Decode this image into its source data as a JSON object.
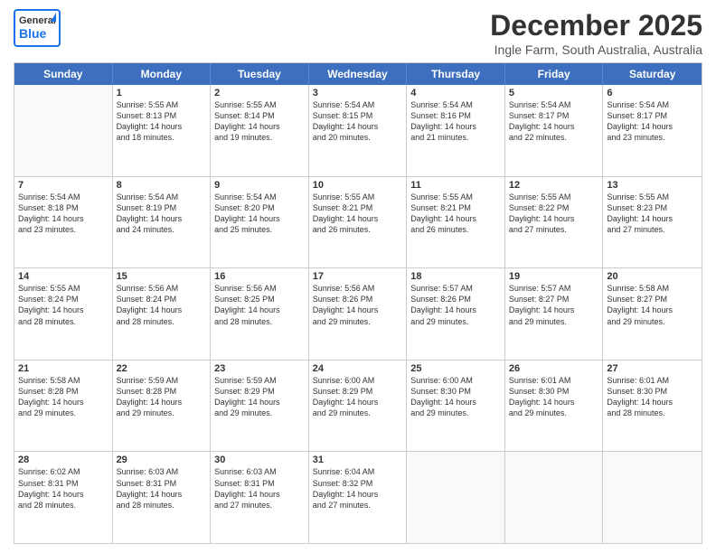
{
  "header": {
    "title": "December 2025",
    "subtitle": "Ingle Farm, South Australia, Australia"
  },
  "days": [
    "Sunday",
    "Monday",
    "Tuesday",
    "Wednesday",
    "Thursday",
    "Friday",
    "Saturday"
  ],
  "weeks": [
    [
      {
        "num": "",
        "lines": []
      },
      {
        "num": "1",
        "lines": [
          "Sunrise: 5:55 AM",
          "Sunset: 8:13 PM",
          "Daylight: 14 hours",
          "and 18 minutes."
        ]
      },
      {
        "num": "2",
        "lines": [
          "Sunrise: 5:55 AM",
          "Sunset: 8:14 PM",
          "Daylight: 14 hours",
          "and 19 minutes."
        ]
      },
      {
        "num": "3",
        "lines": [
          "Sunrise: 5:54 AM",
          "Sunset: 8:15 PM",
          "Daylight: 14 hours",
          "and 20 minutes."
        ]
      },
      {
        "num": "4",
        "lines": [
          "Sunrise: 5:54 AM",
          "Sunset: 8:16 PM",
          "Daylight: 14 hours",
          "and 21 minutes."
        ]
      },
      {
        "num": "5",
        "lines": [
          "Sunrise: 5:54 AM",
          "Sunset: 8:17 PM",
          "Daylight: 14 hours",
          "and 22 minutes."
        ]
      },
      {
        "num": "6",
        "lines": [
          "Sunrise: 5:54 AM",
          "Sunset: 8:17 PM",
          "Daylight: 14 hours",
          "and 23 minutes."
        ]
      }
    ],
    [
      {
        "num": "7",
        "lines": [
          "Sunrise: 5:54 AM",
          "Sunset: 8:18 PM",
          "Daylight: 14 hours",
          "and 23 minutes."
        ]
      },
      {
        "num": "8",
        "lines": [
          "Sunrise: 5:54 AM",
          "Sunset: 8:19 PM",
          "Daylight: 14 hours",
          "and 24 minutes."
        ]
      },
      {
        "num": "9",
        "lines": [
          "Sunrise: 5:54 AM",
          "Sunset: 8:20 PM",
          "Daylight: 14 hours",
          "and 25 minutes."
        ]
      },
      {
        "num": "10",
        "lines": [
          "Sunrise: 5:55 AM",
          "Sunset: 8:21 PM",
          "Daylight: 14 hours",
          "and 26 minutes."
        ]
      },
      {
        "num": "11",
        "lines": [
          "Sunrise: 5:55 AM",
          "Sunset: 8:21 PM",
          "Daylight: 14 hours",
          "and 26 minutes."
        ]
      },
      {
        "num": "12",
        "lines": [
          "Sunrise: 5:55 AM",
          "Sunset: 8:22 PM",
          "Daylight: 14 hours",
          "and 27 minutes."
        ]
      },
      {
        "num": "13",
        "lines": [
          "Sunrise: 5:55 AM",
          "Sunset: 8:23 PM",
          "Daylight: 14 hours",
          "and 27 minutes."
        ]
      }
    ],
    [
      {
        "num": "14",
        "lines": [
          "Sunrise: 5:55 AM",
          "Sunset: 8:24 PM",
          "Daylight: 14 hours",
          "and 28 minutes."
        ]
      },
      {
        "num": "15",
        "lines": [
          "Sunrise: 5:56 AM",
          "Sunset: 8:24 PM",
          "Daylight: 14 hours",
          "and 28 minutes."
        ]
      },
      {
        "num": "16",
        "lines": [
          "Sunrise: 5:56 AM",
          "Sunset: 8:25 PM",
          "Daylight: 14 hours",
          "and 28 minutes."
        ]
      },
      {
        "num": "17",
        "lines": [
          "Sunrise: 5:56 AM",
          "Sunset: 8:26 PM",
          "Daylight: 14 hours",
          "and 29 minutes."
        ]
      },
      {
        "num": "18",
        "lines": [
          "Sunrise: 5:57 AM",
          "Sunset: 8:26 PM",
          "Daylight: 14 hours",
          "and 29 minutes."
        ]
      },
      {
        "num": "19",
        "lines": [
          "Sunrise: 5:57 AM",
          "Sunset: 8:27 PM",
          "Daylight: 14 hours",
          "and 29 minutes."
        ]
      },
      {
        "num": "20",
        "lines": [
          "Sunrise: 5:58 AM",
          "Sunset: 8:27 PM",
          "Daylight: 14 hours",
          "and 29 minutes."
        ]
      }
    ],
    [
      {
        "num": "21",
        "lines": [
          "Sunrise: 5:58 AM",
          "Sunset: 8:28 PM",
          "Daylight: 14 hours",
          "and 29 minutes."
        ]
      },
      {
        "num": "22",
        "lines": [
          "Sunrise: 5:59 AM",
          "Sunset: 8:28 PM",
          "Daylight: 14 hours",
          "and 29 minutes."
        ]
      },
      {
        "num": "23",
        "lines": [
          "Sunrise: 5:59 AM",
          "Sunset: 8:29 PM",
          "Daylight: 14 hours",
          "and 29 minutes."
        ]
      },
      {
        "num": "24",
        "lines": [
          "Sunrise: 6:00 AM",
          "Sunset: 8:29 PM",
          "Daylight: 14 hours",
          "and 29 minutes."
        ]
      },
      {
        "num": "25",
        "lines": [
          "Sunrise: 6:00 AM",
          "Sunset: 8:30 PM",
          "Daylight: 14 hours",
          "and 29 minutes."
        ]
      },
      {
        "num": "26",
        "lines": [
          "Sunrise: 6:01 AM",
          "Sunset: 8:30 PM",
          "Daylight: 14 hours",
          "and 29 minutes."
        ]
      },
      {
        "num": "27",
        "lines": [
          "Sunrise: 6:01 AM",
          "Sunset: 8:30 PM",
          "Daylight: 14 hours",
          "and 28 minutes."
        ]
      }
    ],
    [
      {
        "num": "28",
        "lines": [
          "Sunrise: 6:02 AM",
          "Sunset: 8:31 PM",
          "Daylight: 14 hours",
          "and 28 minutes."
        ]
      },
      {
        "num": "29",
        "lines": [
          "Sunrise: 6:03 AM",
          "Sunset: 8:31 PM",
          "Daylight: 14 hours",
          "and 28 minutes."
        ]
      },
      {
        "num": "30",
        "lines": [
          "Sunrise: 6:03 AM",
          "Sunset: 8:31 PM",
          "Daylight: 14 hours",
          "and 27 minutes."
        ]
      },
      {
        "num": "31",
        "lines": [
          "Sunrise: 6:04 AM",
          "Sunset: 8:32 PM",
          "Daylight: 14 hours",
          "and 27 minutes."
        ]
      },
      {
        "num": "",
        "lines": []
      },
      {
        "num": "",
        "lines": []
      },
      {
        "num": "",
        "lines": []
      }
    ]
  ]
}
